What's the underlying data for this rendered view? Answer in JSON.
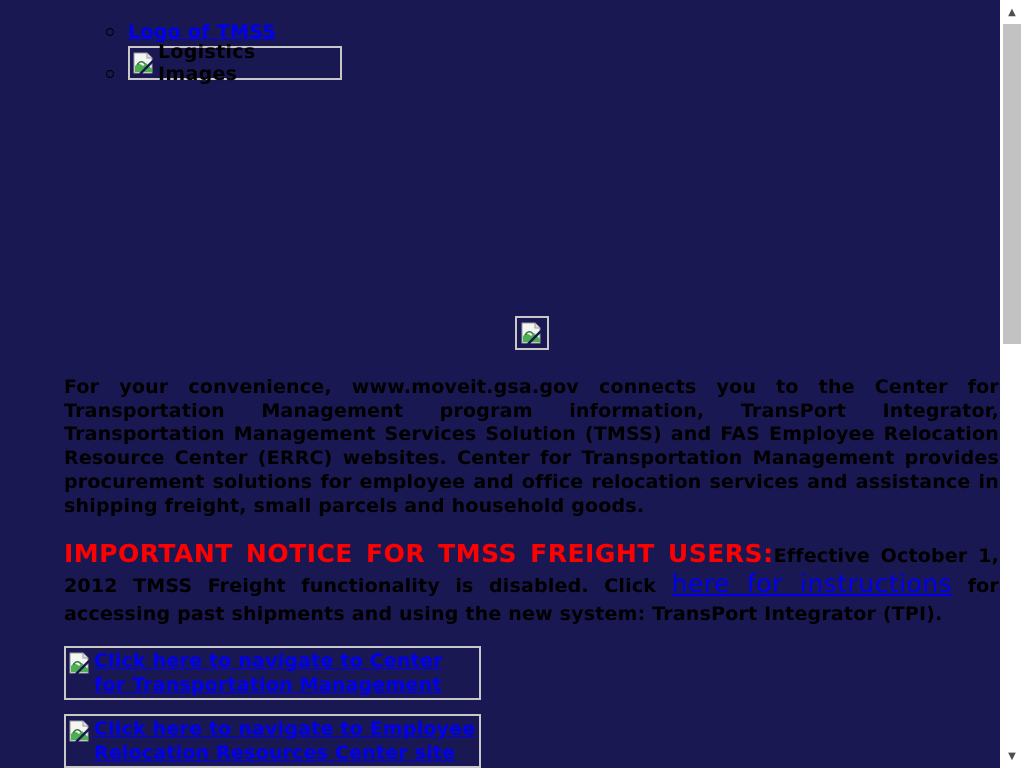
{
  "top_list": {
    "logo_link": "Logo of TMSS",
    "logistics_alt": "Logistics Images"
  },
  "intro": "For your convenience, www.moveit.gsa.gov connects you to the Center for Transportation Management program information, TransPort Integrator, Transportation Management Services Solution (TMSS) and FAS Employee Relocation Resource Center (ERRC) websites. Center for Transportation Management provides procurement solutions for employee and office relocation services and assistance in shipping freight, small parcels and household goods.",
  "notice": {
    "heading": "IMPORTANT NOTICE FOR TMSS FREIGHT USERS:",
    "text_before": "Effective October 1, 2012 TMSS Freight functionality is disabled. Click ",
    "link": "here for instructions",
    "text_after": " for accessing past shipments and using the new system: TransPort Integrator (TPI)."
  },
  "nav_links": {
    "ctm": "Click here to navigate to Center for Transportation Management",
    "errc": "Click here to navigate to Employee Relocation Resources Center site"
  },
  "colors": {
    "background": "#1a1852",
    "notice_red": "#ff0000",
    "link_blue": "#0000ee"
  },
  "icons": {
    "broken_image": "broken-image-icon",
    "scroll_up": "chevron-up-icon",
    "scroll_down": "chevron-down-icon"
  }
}
